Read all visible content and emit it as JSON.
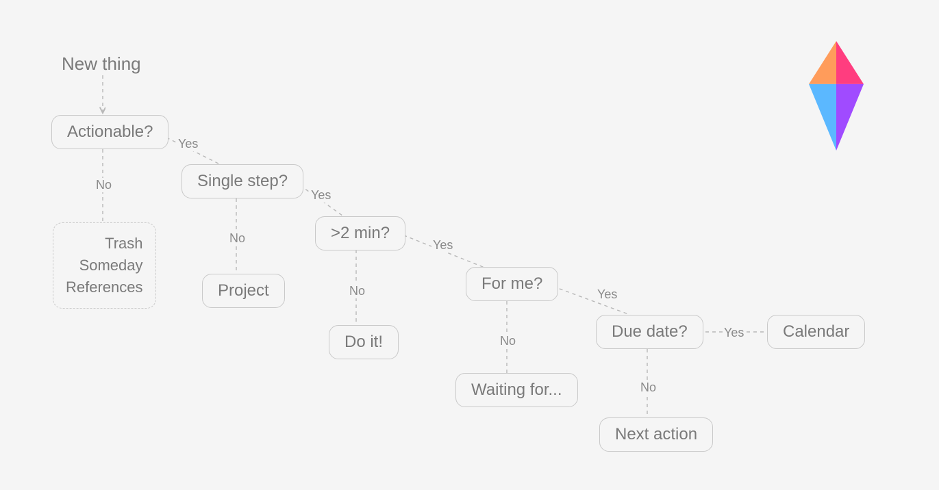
{
  "diagram": {
    "start": "New thing",
    "nodes": {
      "actionable": "Actionable?",
      "singlestep": "Single step?",
      "twomin": ">2 min?",
      "forme": "For me?",
      "duedate": "Due date?",
      "trash": "Trash",
      "someday": "Someday",
      "references": "References",
      "project": "Project",
      "doit": "Do it!",
      "waiting": "Waiting for...",
      "nextaction": "Next action",
      "calendar": "Calendar"
    },
    "edges": {
      "yes": "Yes",
      "no": "No"
    }
  }
}
